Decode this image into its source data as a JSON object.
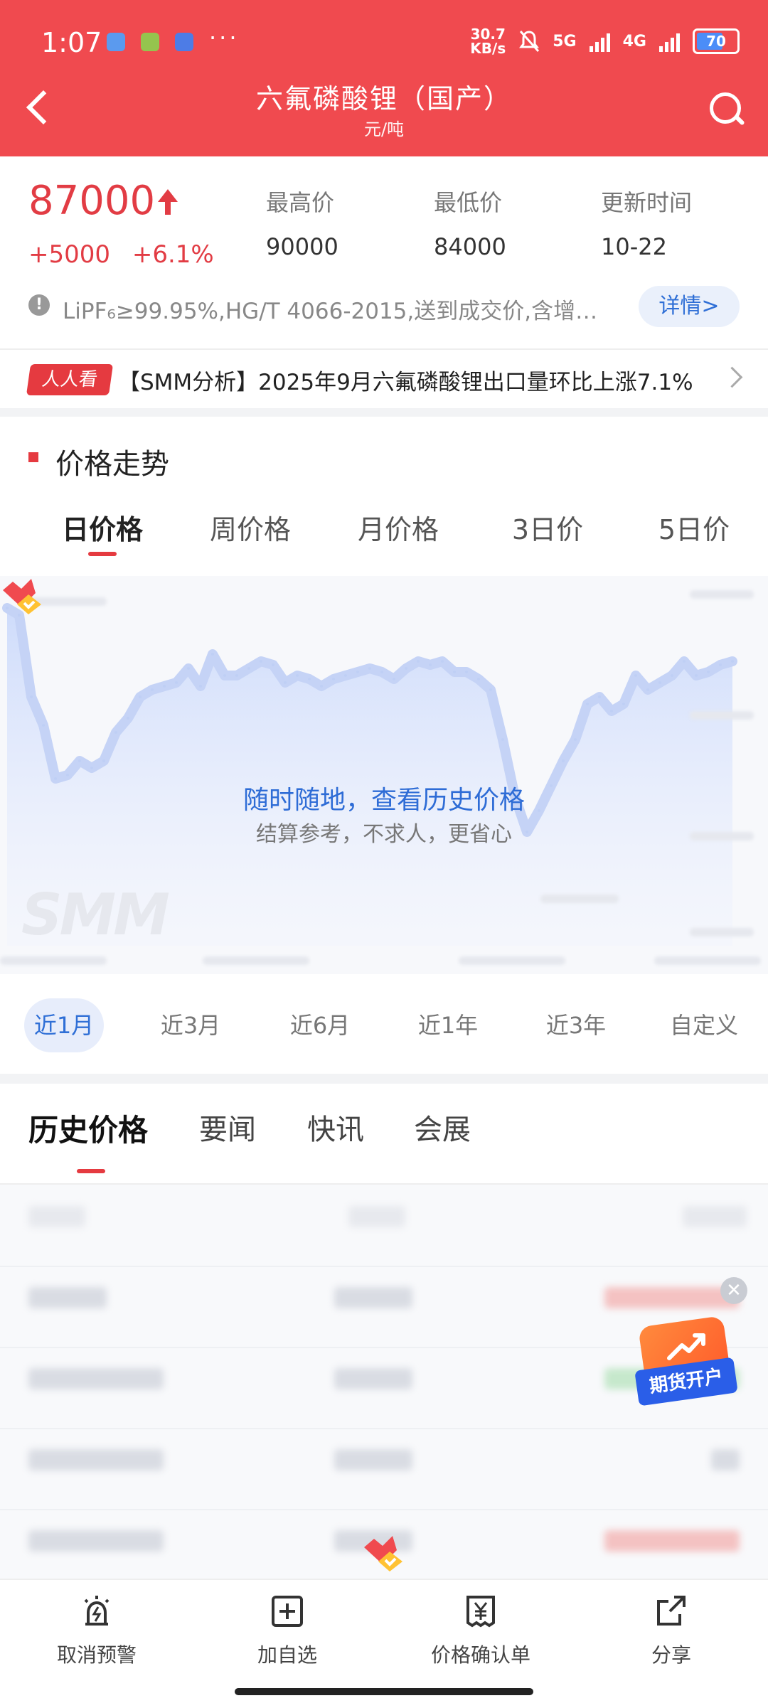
{
  "status_bar": {
    "time": "1:07",
    "more": "···",
    "net_speed_top": "30.7",
    "net_speed_bottom": "KB/s",
    "net1": "5G",
    "net2": "4G",
    "battery": "70"
  },
  "header": {
    "title": "六氟磷酸锂（国产）",
    "unit": "元/吨"
  },
  "price": {
    "current": "87000",
    "change_abs": "+5000",
    "change_pct": "+6.1%",
    "high_label": "最高价",
    "high_value": "90000",
    "low_label": "最低价",
    "low_value": "84000",
    "update_label": "更新时间",
    "update_value": "10-22",
    "info_icon": "!",
    "spec_text": "LiPF₆≥99.95%,HG/T 4066-2015,送到成交价,含增…",
    "detail_button": "详情>"
  },
  "news": {
    "tag": "人人看",
    "text": "【SMM分析】2025年9月六氟磷酸锂出口量环比上涨7.1%"
  },
  "trend": {
    "title": "价格走势",
    "period_tabs": [
      "日价格",
      "周价格",
      "月价格",
      "3日价",
      "5日价"
    ],
    "active_period": 0,
    "watermark": "SMM",
    "promo_main": "随时随地，查看历史价格",
    "promo_sub": "结算参考，不求人，更省心"
  },
  "chart_data": {
    "type": "area",
    "note_visible": "blurred",
    "values": [
      95,
      93,
      70,
      62,
      47,
      48,
      52,
      50,
      52,
      60,
      64,
      70,
      72,
      73,
      74,
      78,
      73,
      82,
      76,
      76,
      78,
      80,
      79,
      74,
      76,
      75,
      73,
      75,
      76,
      77,
      78,
      77,
      75,
      78,
      80,
      79,
      80,
      77,
      77,
      75,
      72,
      58,
      42,
      32,
      38,
      45,
      52,
      58,
      68,
      70,
      66,
      68,
      76,
      72,
      74,
      76,
      80,
      76,
      77,
      79,
      80
    ],
    "ylim": [
      0,
      100
    ],
    "grid": false
  },
  "range_tabs": {
    "items": [
      "近1月",
      "近3月",
      "近6月",
      "近1年",
      "近3年",
      "自定义"
    ],
    "active": 0
  },
  "content_tabs": {
    "items": [
      "历史价格",
      "要闻",
      "快讯",
      "会展"
    ],
    "active": 0
  },
  "float_ad": {
    "close": "✕",
    "label": "期货开户"
  },
  "bottom_bar": {
    "items": [
      "取消预警",
      "加自选",
      "价格确认单",
      "分享"
    ]
  },
  "colors": {
    "brand_red": "#f04a4f",
    "price_red": "#e23c44",
    "link_blue": "#2f6fd6"
  }
}
